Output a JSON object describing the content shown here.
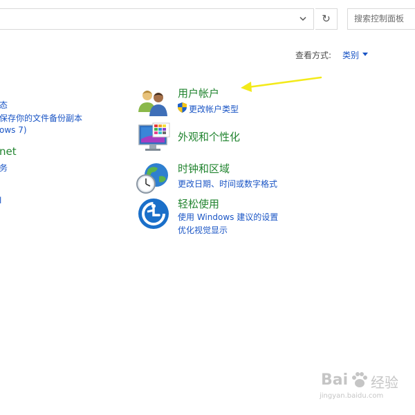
{
  "toolbar": {
    "refresh_icon": "refresh-icon",
    "dropdown_icon": "chevron-down-icon",
    "search_placeholder": "搜索控制面板"
  },
  "view_by": {
    "label": "查看方式:",
    "value": "类别"
  },
  "left_column": {
    "items": [
      "态",
      "保存你的文件备份副本",
      "ows 7)",
      "net",
      "务",
      "l"
    ]
  },
  "categories": [
    {
      "title": "用户帐户",
      "links": [
        "更改帐户类型"
      ],
      "icon": "users-icon",
      "link_icon": "uac-shield-icon"
    },
    {
      "title": "外观和个性化",
      "links": [],
      "icon": "monitor-personalize-icon"
    },
    {
      "title": "时钟和区域",
      "links": [
        "更改日期、时间或数字格式"
      ],
      "icon": "clock-globe-icon"
    },
    {
      "title": "轻松使用",
      "links": [
        "使用 Windows 建议的设置",
        "优化视觉显示"
      ],
      "icon": "ease-of-access-icon"
    }
  ],
  "watermark": {
    "brand_left": "Bai",
    "brand_right": "经验",
    "url": "jingyan.baidu.com"
  },
  "colors": {
    "category_title": "#21842f",
    "link": "#1a55c5",
    "arrow_annotation": "#f3ea1a"
  }
}
